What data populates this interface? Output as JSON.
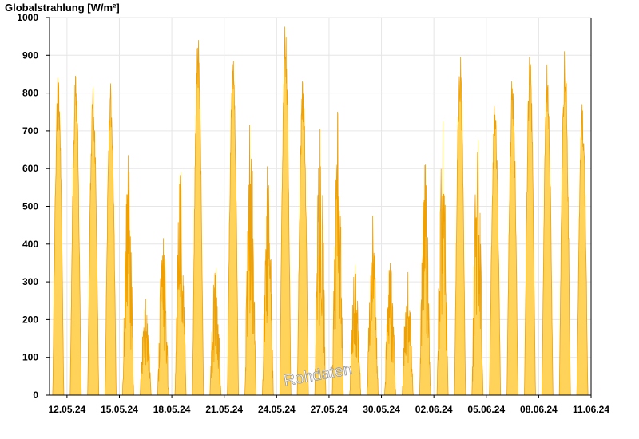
{
  "chart_data": {
    "type": "area",
    "ylabel": "Globalstrahlung [W/m²]",
    "ylim": [
      0,
      1000
    ],
    "yticks": [
      0,
      100,
      200,
      300,
      400,
      500,
      600,
      700,
      800,
      900,
      1000
    ],
    "xticks": [
      "12.05.24",
      "15.05.24",
      "18.05.24",
      "21.05.24",
      "24.05.24",
      "27.05.24",
      "30.05.24",
      "02.06.24",
      "05.06.24",
      "08.06.24",
      "11.06.24"
    ],
    "watermark": "Rohdaten",
    "grid": true,
    "colors": {
      "fill": "#ffd35a",
      "line": "#f0a000",
      "grid": "#e6e6e6"
    },
    "series": [
      {
        "daily_peaks": [
          {
            "date": "11.05.24",
            "peak": 840
          },
          {
            "date": "12.05.24",
            "peak": 845
          },
          {
            "date": "13.05.24",
            "peak": 815
          },
          {
            "date": "14.05.24",
            "peak": 825
          },
          {
            "date": "15.05.24",
            "peak": 635
          },
          {
            "date": "16.05.24",
            "peak": 255
          },
          {
            "date": "17.05.24",
            "peak": 415
          },
          {
            "date": "18.05.24",
            "peak": 590
          },
          {
            "date": "19.05.24",
            "peak": 940
          },
          {
            "date": "20.05.24",
            "peak": 335
          },
          {
            "date": "21.05.24",
            "peak": 885
          },
          {
            "date": "22.05.24",
            "peak": 715
          },
          {
            "date": "23.05.24",
            "peak": 605
          },
          {
            "date": "24.05.24",
            "peak": 975
          },
          {
            "date": "25.05.24",
            "peak": 830
          },
          {
            "date": "26.05.24",
            "peak": 705
          },
          {
            "date": "27.05.24",
            "peak": 750
          },
          {
            "date": "28.05.24",
            "peak": 345
          },
          {
            "date": "29.05.24",
            "peak": 475
          },
          {
            "date": "30.05.24",
            "peak": 350
          },
          {
            "date": "31.05.24",
            "peak": 325
          },
          {
            "date": "01.06.24",
            "peak": 610
          },
          {
            "date": "02.06.24",
            "peak": 725
          },
          {
            "date": "03.06.24",
            "peak": 895
          },
          {
            "date": "04.06.24",
            "peak": 675
          },
          {
            "date": "05.06.24",
            "peak": 765
          },
          {
            "date": "06.06.24",
            "peak": 830
          },
          {
            "date": "07.06.24",
            "peak": 895
          },
          {
            "date": "08.06.24",
            "peak": 875
          },
          {
            "date": "09.06.24",
            "peak": 910
          },
          {
            "date": "10.06.24",
            "peak": 770
          }
        ]
      }
    ]
  }
}
